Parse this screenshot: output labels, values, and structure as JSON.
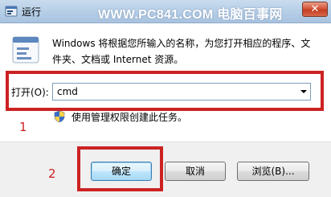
{
  "window": {
    "title": "运行",
    "watermark": "WWW.PC841.COM 电脑百事网",
    "close_glyph": "✕"
  },
  "dialog": {
    "description": "Windows 将根据您所输入的名称，为您打开相应的程序、文件夹、文档或 Internet 资源。",
    "open_label": "打开(O):",
    "open_value": "cmd",
    "admin_note": "使用管理权限创建此任务。"
  },
  "buttons": {
    "ok": "确定",
    "cancel": "取消",
    "browse": "浏览(B)..."
  },
  "annotations": {
    "marker_1": "1",
    "marker_2": "2"
  },
  "colors": {
    "highlight": "#cc2222",
    "titlebar": "#b5cde6",
    "footer": "#f0f0f0"
  },
  "icons": {
    "app": "run-app-icon",
    "info": "info-icon",
    "shield": "uac-shield-icon",
    "dropdown": "chevron-down-icon",
    "close": "close-icon"
  }
}
